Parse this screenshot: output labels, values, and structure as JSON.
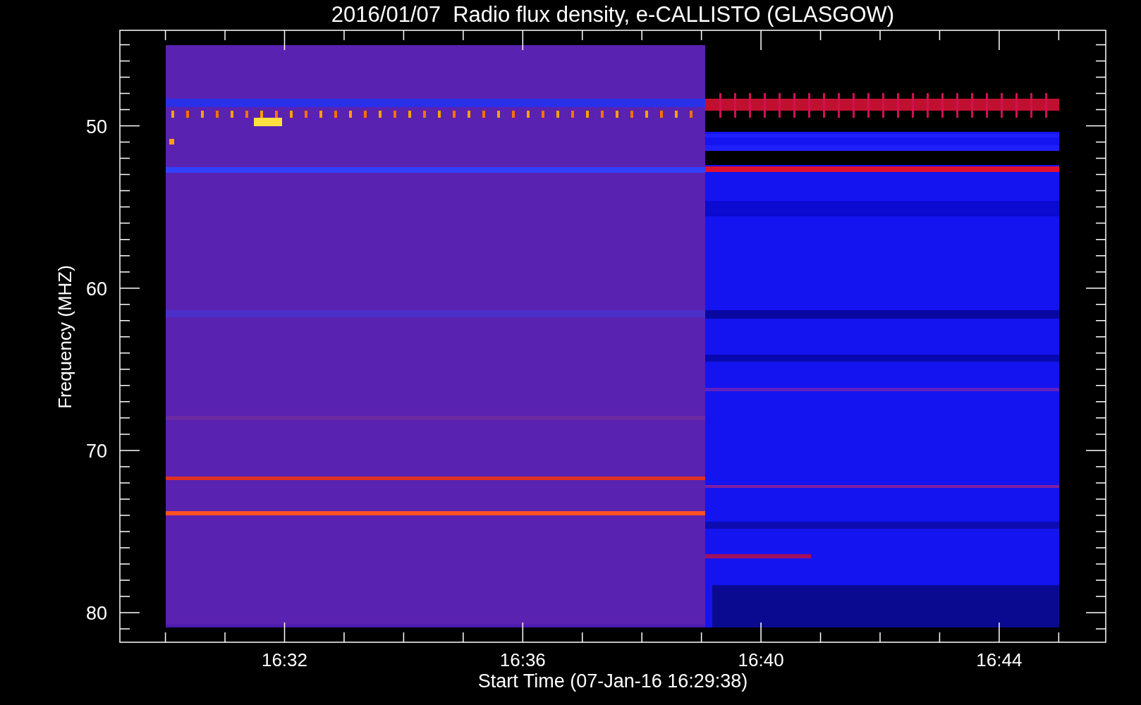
{
  "title": "2016/01/07  Radio flux density, e-CALLISTO (GLASGOW)",
  "y_axis": {
    "label": "Frequency (MHZ)",
    "ticks": [
      "50",
      "60",
      "70",
      "80"
    ]
  },
  "x_axis": {
    "label": "Start Time (07-Jan-16 16:29:38)",
    "ticks": [
      "16:32",
      "16:36",
      "16:40",
      "16:44"
    ]
  }
}
